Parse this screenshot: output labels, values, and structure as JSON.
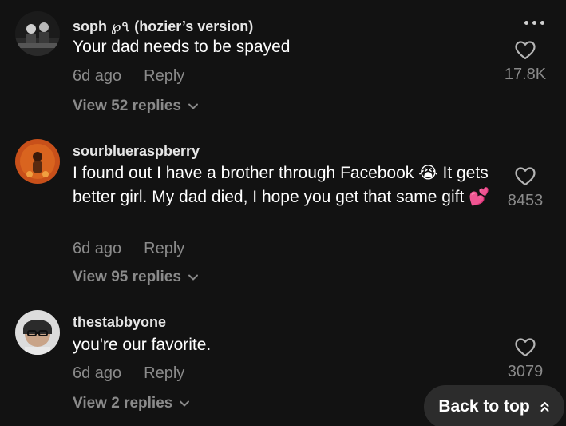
{
  "comments": [
    {
      "username": "soph ℘৭ (hozier’s version)",
      "text": "Your dad needs to be spayed",
      "age": "6d ago",
      "reply_label": "Reply",
      "likes": "17.8K",
      "view_replies": "View 52 replies"
    },
    {
      "username": "sourblueraspberry",
      "text": "I found out I have a brother through Facebook 😭 It gets better girl. My dad died, I hope you get that same gift 💕",
      "age": "6d ago",
      "reply_label": "Reply",
      "likes": "8453",
      "view_replies": "View 95 replies"
    },
    {
      "username": "thestabbyone",
      "text": "you're our favorite.",
      "age": "6d ago",
      "reply_label": "Reply",
      "likes": "3079",
      "view_replies": "View 2 replies"
    }
  ],
  "back_to_top": "Back to top",
  "colors": {
    "background": "#121212",
    "muted_text": "#8a8a8a",
    "pill": "#2c2c2c"
  },
  "icons": {
    "like": "heart-outline-icon",
    "more": "more-horizontal-icon",
    "expand": "chevron-down-icon",
    "back_to_top": "double-chevron-up-icon"
  }
}
